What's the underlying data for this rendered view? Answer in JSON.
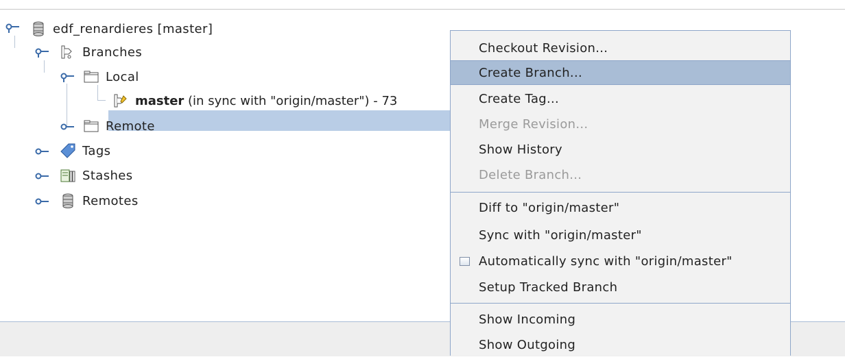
{
  "tree": {
    "repo_label": "edf_renardieres [master]",
    "branches_label": "Branches",
    "local_label": "Local",
    "master_branch_name": "master",
    "master_branch_detail": " (in sync with \"origin/master\") - 73",
    "remote_label": "Remote",
    "tags_label": "Tags",
    "stashes_label": "Stashes",
    "remotes_label": "Remotes"
  },
  "context_menu": {
    "checkout_revision": "Checkout Revision...",
    "create_branch": "Create Branch...",
    "create_tag": "Create Tag...",
    "merge_revision": "Merge Revision...",
    "show_history": "Show History",
    "delete_branch": "Delete Branch...",
    "diff_to": "Diff to \"origin/master\"",
    "sync_with": "Sync with \"origin/master\"",
    "auto_sync": "Automatically sync with \"origin/master\"",
    "setup_tracked": "Setup Tracked Branch",
    "show_incoming": "Show Incoming",
    "show_outgoing": "Show Outgoing"
  },
  "colors": {
    "selection": "#b9cde6",
    "menu_hover": "#a9bdd6",
    "menu_border": "#8ea6c9",
    "disabled_text": "#9a9a9a"
  },
  "icons": [
    "expanded-handle-icon",
    "collapsed-handle-icon",
    "database-icon",
    "branches-icon",
    "folder-icon",
    "branch-icon",
    "tag-icon",
    "stash-icon"
  ]
}
